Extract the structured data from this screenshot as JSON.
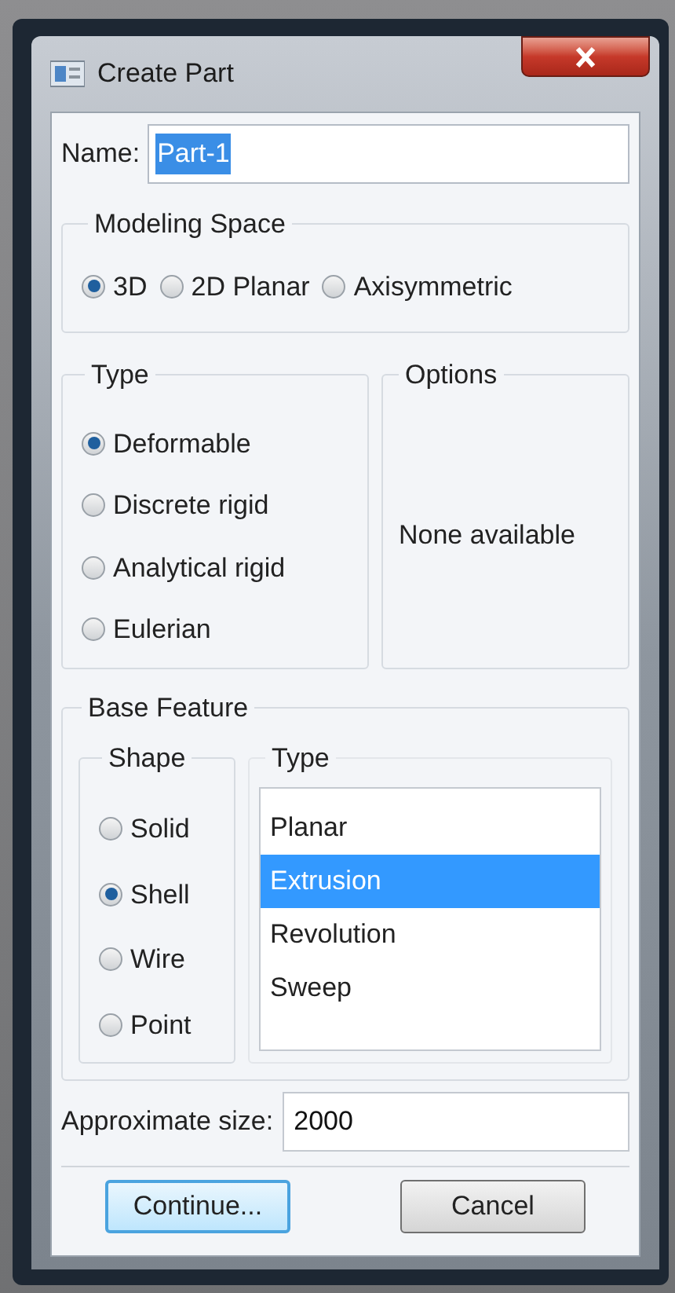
{
  "window": {
    "title": "Create Part"
  },
  "name": {
    "label": "Name:",
    "value": "Part-1",
    "text_selected": true
  },
  "modeling_space": {
    "title": "Modeling Space",
    "options": [
      {
        "label": "3D",
        "selected": true
      },
      {
        "label": "2D Planar",
        "selected": false
      },
      {
        "label": "Axisymmetric",
        "selected": false
      }
    ]
  },
  "type": {
    "title": "Type",
    "options": [
      {
        "label": "Deformable",
        "selected": true
      },
      {
        "label": "Discrete rigid",
        "selected": false
      },
      {
        "label": "Analytical rigid",
        "selected": false
      },
      {
        "label": "Eulerian",
        "selected": false
      }
    ]
  },
  "options": {
    "title": "Options",
    "message": "None available"
  },
  "base_feature": {
    "title": "Base Feature",
    "shape": {
      "title": "Shape",
      "options": [
        {
          "label": "Solid",
          "selected": false
        },
        {
          "label": "Shell",
          "selected": true
        },
        {
          "label": "Wire",
          "selected": false
        },
        {
          "label": "Point",
          "selected": false
        }
      ]
    },
    "type": {
      "title": "Type",
      "items": [
        {
          "label": "Planar",
          "selected": false
        },
        {
          "label": "Extrusion",
          "selected": true
        },
        {
          "label": "Revolution",
          "selected": false
        },
        {
          "label": "Sweep",
          "selected": false
        }
      ]
    }
  },
  "approximate_size": {
    "label": "Approximate size:",
    "value": "2000"
  },
  "buttons": [
    {
      "label": "Continue...",
      "focused": true
    },
    {
      "label": "Cancel",
      "focused": false
    }
  ]
}
